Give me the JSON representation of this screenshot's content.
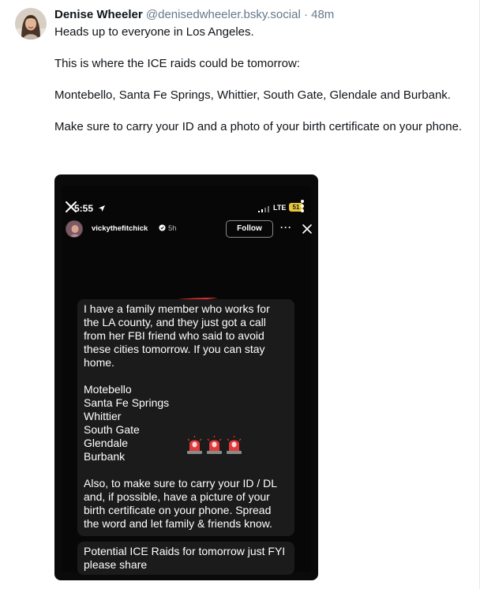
{
  "post": {
    "author_name": "Denise Wheeler",
    "author_handle": "@denisedwheeler.bsky.social",
    "separator": "·",
    "time": "48m",
    "text": [
      "Heads up to everyone in Los Angeles.",
      "This is where the ICE raids could be tomorrow:",
      "Montebello, Santa Fe Springs, Whittier, South Gate, Glendale and Burbank.",
      "Make sure to carry your ID and a photo of your birth certificate on your phone."
    ]
  },
  "embed": {
    "status": {
      "time": "5:55",
      "network": "LTE",
      "battery": "51"
    },
    "story": {
      "username": "vickythefitchick",
      "age": "5h",
      "follow_label": "Follow",
      "more_label": "···"
    },
    "note": {
      "intro": "I have a family member who works for the LA county, and they just got a call from her FBI friend who said to avoid these cities tomorrow. If you can stay home.",
      "cities": [
        "Motebello",
        "Santa Fe Springs",
        "Whittier",
        "South Gate",
        "Glendale",
        "Burbank"
      ],
      "outro": "Also, to make sure to carry your ID / DL and, if possible, have a picture of your birth certificate on your phone. Spread the word and let family & friends know.",
      "share": "Potential ICE Raids for tomorrow just FYI please share"
    },
    "icons": [
      "close-icon",
      "location-arrow-icon",
      "signal-icon",
      "battery-icon",
      "more-vertical-icon",
      "verified-icon",
      "siren-icon"
    ]
  },
  "colors": {
    "handle": "#66788a",
    "text": "#0f1419",
    "embed_bg": "#0a0a0a",
    "note_bg": "#1b1b1b",
    "battery": "#e8c53a",
    "siren": "#e03a3a"
  }
}
